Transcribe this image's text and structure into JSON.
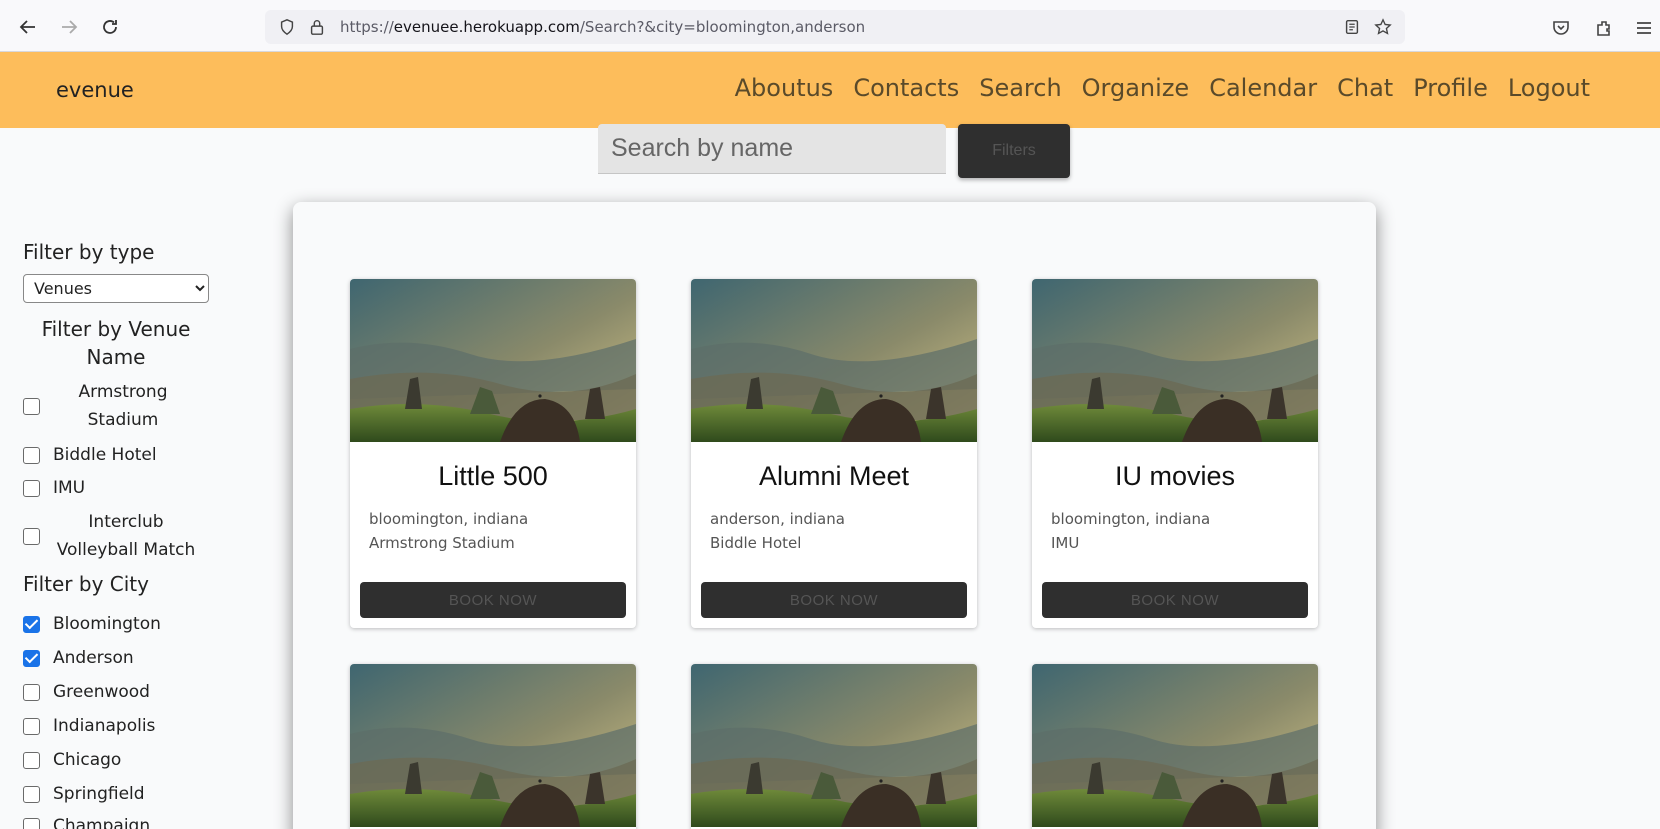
{
  "browser": {
    "url_prefix": "https://",
    "url_host": "evenuee.herokuapp.com",
    "url_path": "/Search?&city=bloomington,anderson"
  },
  "navbar": {
    "brand": "evenue",
    "links": [
      "Aboutus",
      "Contacts",
      "Search",
      "Organize",
      "Calendar",
      "Chat",
      "Profile",
      "Logout"
    ]
  },
  "search": {
    "placeholder": "Search by name",
    "filters_label": "Filters"
  },
  "sidebar": {
    "type_heading": "Filter by type",
    "type_selected": "Venues",
    "venue_heading": "Filter by Venue Name",
    "venues": [
      {
        "label": "Armstrong Stadium",
        "checked": false
      },
      {
        "label": "Biddle Hotel",
        "checked": false
      },
      {
        "label": "IMU",
        "checked": false
      },
      {
        "label": "Interclub Volleyball Match",
        "checked": false
      }
    ],
    "city_heading": "Filter by City",
    "cities": [
      {
        "label": "Bloomington",
        "checked": true
      },
      {
        "label": "Anderson",
        "checked": true
      },
      {
        "label": "Greenwood",
        "checked": false
      },
      {
        "label": "Indianapolis",
        "checked": false
      },
      {
        "label": "Chicago",
        "checked": false
      },
      {
        "label": "Springfield",
        "checked": false
      },
      {
        "label": "Champaign",
        "checked": false
      }
    ]
  },
  "cards": [
    {
      "title": "Little 500",
      "city": "bloomington, indiana",
      "venue": "Armstrong Stadium",
      "button": "BOOK NOW"
    },
    {
      "title": "Alumni Meet",
      "city": "anderson, indiana",
      "venue": "Biddle Hotel",
      "button": "BOOK NOW"
    },
    {
      "title": "IU movies",
      "city": "bloomington, indiana",
      "venue": "IMU",
      "button": "BOOK NOW"
    },
    {
      "title": "",
      "city": "",
      "venue": "",
      "button": ""
    },
    {
      "title": "",
      "city": "",
      "venue": "",
      "button": ""
    },
    {
      "title": "",
      "city": "",
      "venue": "",
      "button": ""
    }
  ]
}
